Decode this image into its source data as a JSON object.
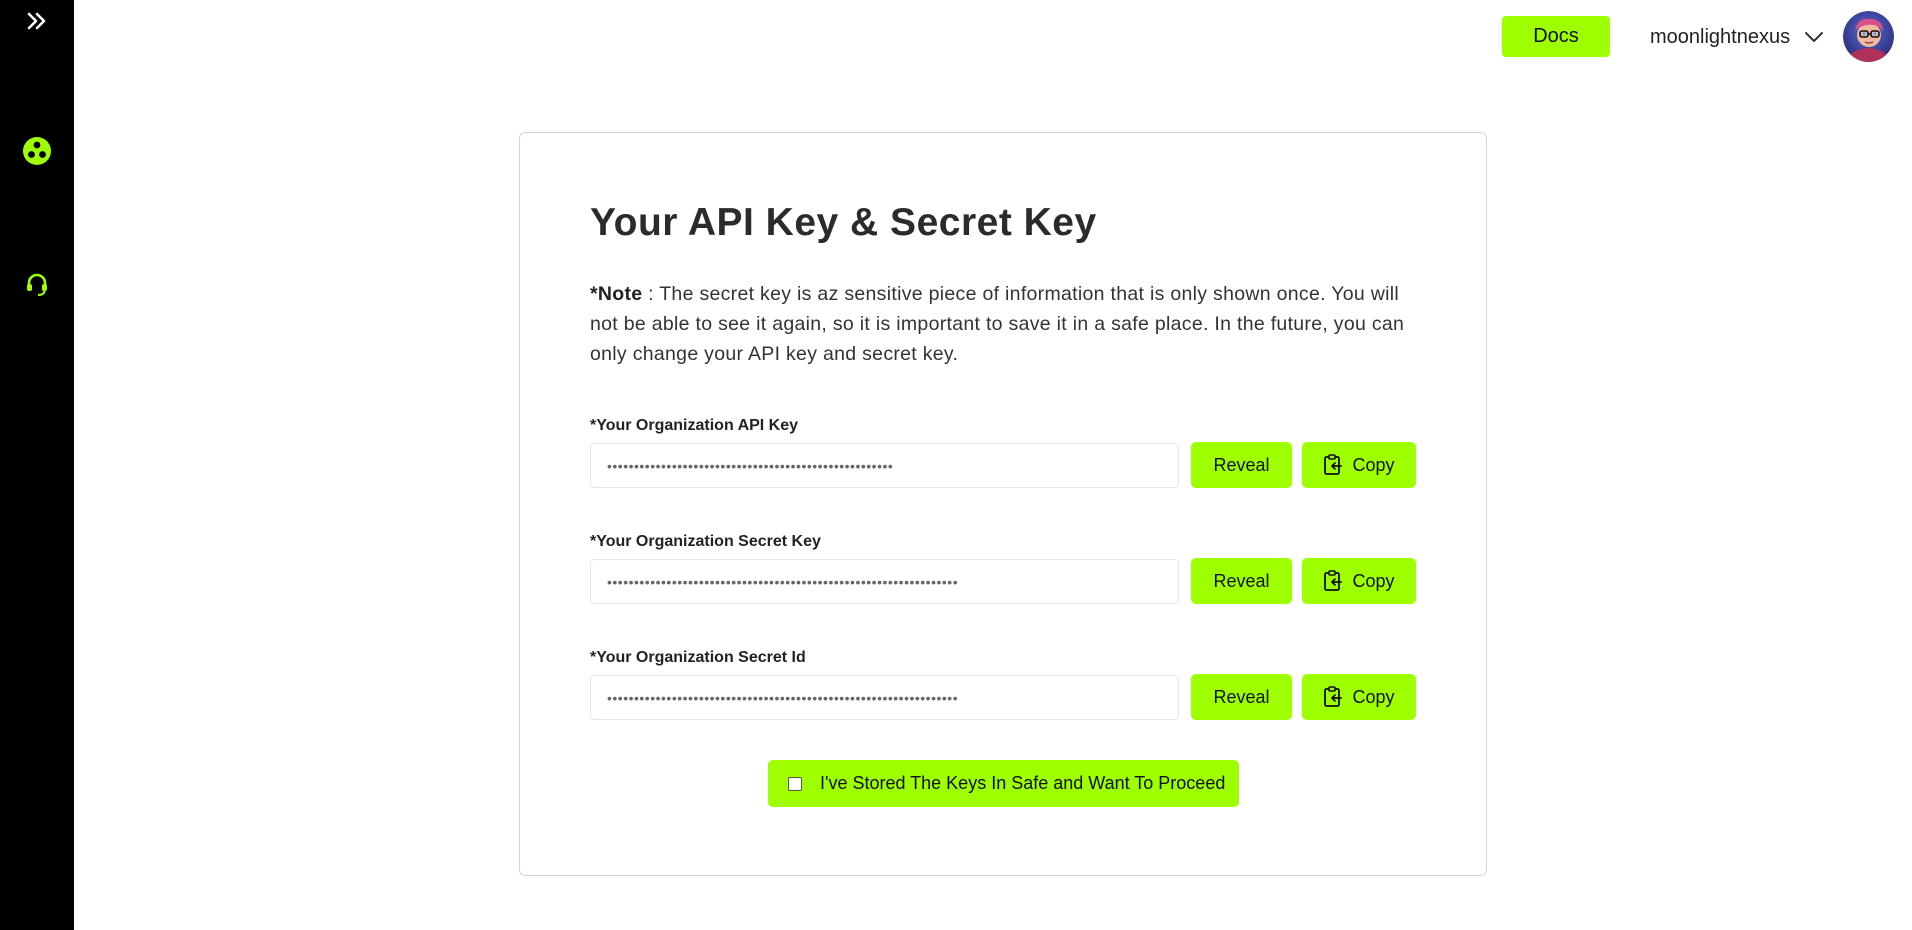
{
  "sidebar": {
    "expand_icon": "double-chevron-right-icon",
    "items": [
      {
        "name": "dashboard",
        "icon": "three-dots-circle-icon"
      },
      {
        "name": "support",
        "icon": "headset-icon"
      }
    ]
  },
  "header": {
    "docs_label": "Docs",
    "username": "moonlightnexus",
    "dropdown_icon": "chevron-down-icon"
  },
  "card": {
    "title": "Your API Key & Secret Key",
    "note_label": "*Note",
    "note_text": " : The secret key is az sensitive piece of information that is only shown once. You will not be able to see it again, so it is important to save it in a safe place. In the future, you can only change your API key and secret key.",
    "fields": [
      {
        "label": "*Your Organization API Key",
        "value": "•••••••••••••••••••••••••••••••••••••••••••••••••••••",
        "reveal_label": "Reveal",
        "copy_label": "Copy"
      },
      {
        "label": "*Your Organization Secret Key",
        "value": "•••••••••••••••••••••••••••••••••••••••••••••••••••••••••••••••••",
        "reveal_label": "Reveal",
        "copy_label": "Copy"
      },
      {
        "label": "*Your Organization Secret Id",
        "value": "•••••••••••••••••••••••••••••••••••••••••••••••••••••••••••••••••",
        "reveal_label": "Reveal",
        "copy_label": "Copy"
      }
    ],
    "proceed_label": "I've Stored The Keys In Safe and Want To Proceed",
    "proceed_checked": false
  },
  "colors": {
    "accent": "#9dff00",
    "sidebar_bg": "#000000",
    "card_border": "#d6d6d6"
  }
}
